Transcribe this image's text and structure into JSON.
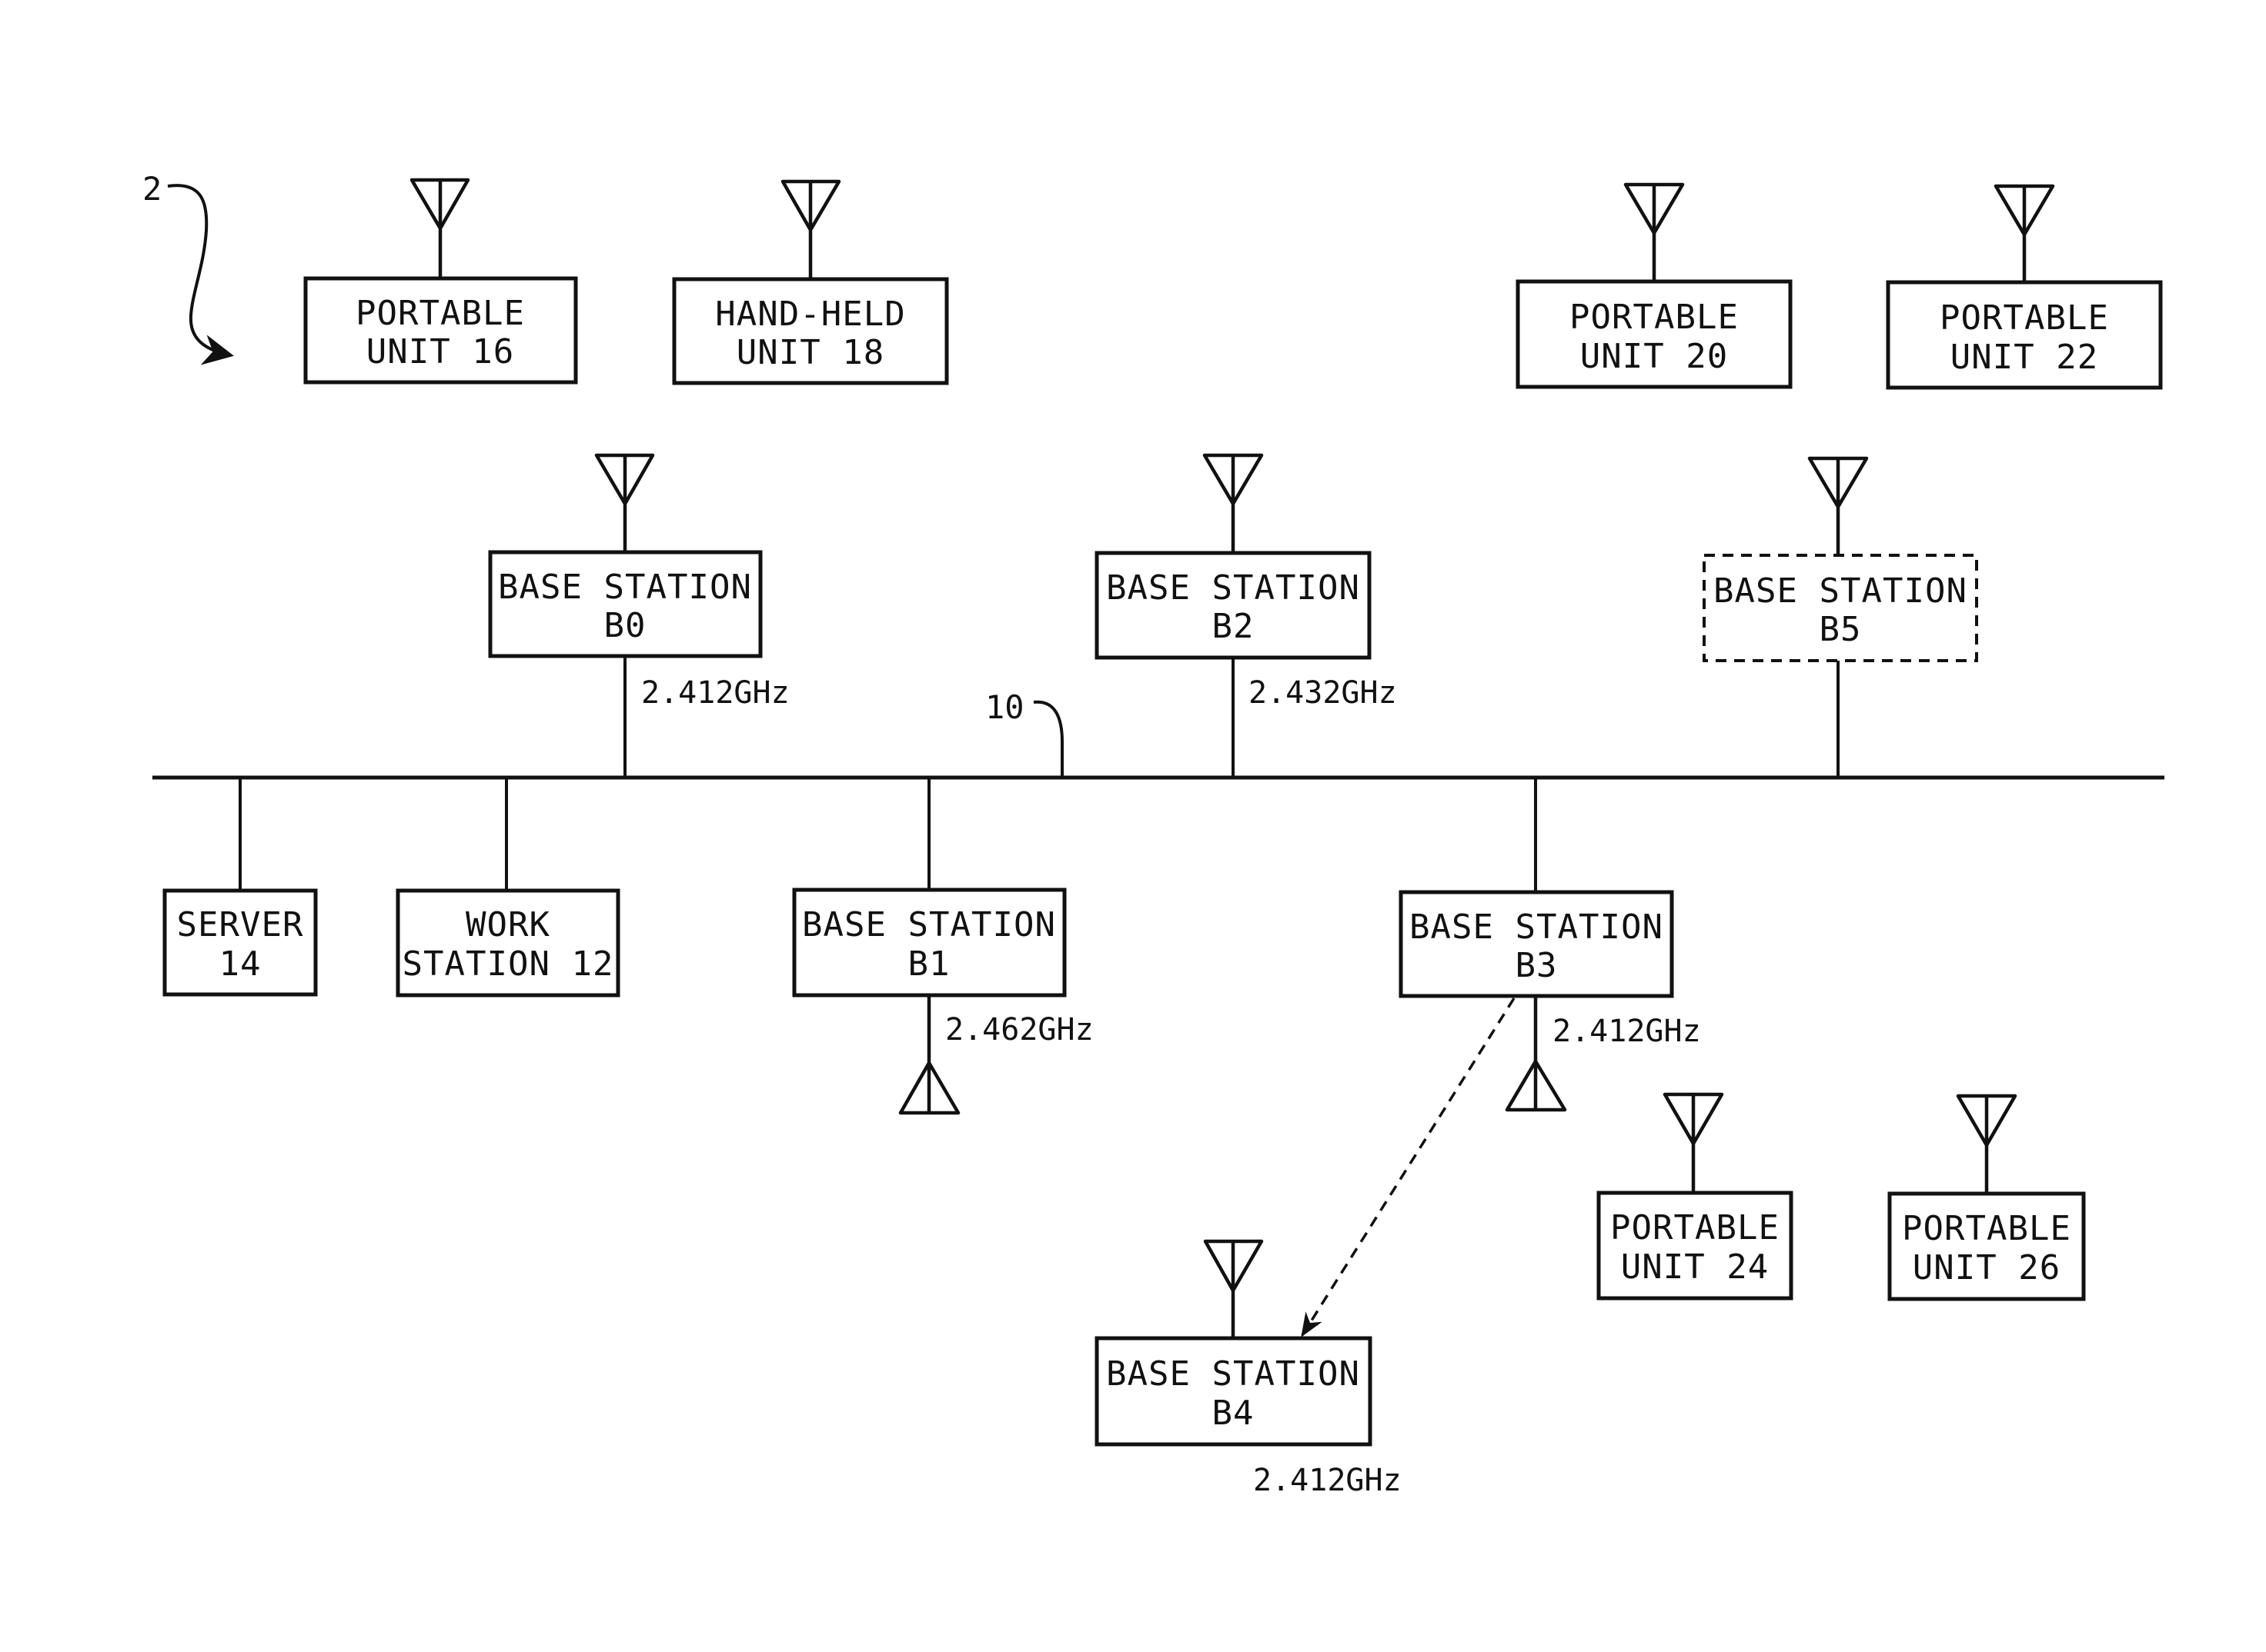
{
  "figure": {
    "reference_numeral": "2",
    "network_label": "10"
  },
  "colors": {
    "ink": "#111111",
    "background": "#ffffff"
  },
  "nodes": {
    "portable_16": {
      "line1": "PORTABLE",
      "line2": "UNIT 16"
    },
    "handheld_18": {
      "line1": "HAND-HELD",
      "line2": "UNIT 18"
    },
    "portable_20": {
      "line1": "PORTABLE",
      "line2": "UNIT 20"
    },
    "portable_22": {
      "line1": "PORTABLE",
      "line2": "UNIT 22"
    },
    "base_b0": {
      "line1": "BASE STATION",
      "line2": "B0",
      "frequency": "2.412GHz"
    },
    "base_b2": {
      "line1": "BASE STATION",
      "line2": "B2",
      "frequency": "2.432GHz"
    },
    "base_b5": {
      "line1": "BASE STATION",
      "line2": "B5",
      "style": "dashed"
    },
    "server_14": {
      "line1": "SERVER",
      "line2": "14"
    },
    "workstation_12": {
      "line1": "WORK",
      "line2": "STATION 12"
    },
    "base_b1": {
      "line1": "BASE STATION",
      "line2": "B1",
      "frequency": "2.462GHz"
    },
    "base_b3": {
      "line1": "BASE STATION",
      "line2": "B3",
      "frequency": "2.412GHz"
    },
    "portable_24": {
      "line1": "PORTABLE",
      "line2": "UNIT 24"
    },
    "portable_26": {
      "line1": "PORTABLE",
      "line2": "UNIT 26"
    },
    "base_b4": {
      "line1": "BASE STATION",
      "line2": "B4",
      "frequency": "2.412GHz"
    }
  },
  "links": [
    {
      "from": "base_b3",
      "to": "base_b4",
      "style": "dashed-arrow"
    }
  ]
}
